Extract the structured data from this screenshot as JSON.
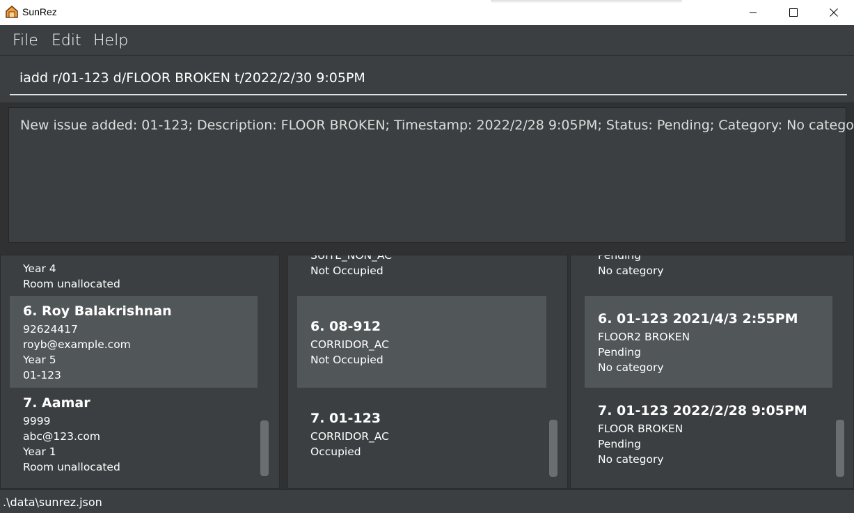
{
  "window": {
    "title": "SunRez"
  },
  "menu": {
    "file": "File",
    "edit": "Edit",
    "help": "Help"
  },
  "command": {
    "value": "iadd r/01-123 d/FLOOR BROKEN t/2022/2/30 9:05PM"
  },
  "result": {
    "text": "New issue added: 01-123; Description: FLOOR BROKEN; Timestamp: 2022/2/28 9:05PM; Status: Pending; Category: No category"
  },
  "residents": {
    "partial_top": {
      "year": "Year 4",
      "room": "Room unallocated"
    },
    "items": [
      {
        "title": "6.  Roy Balakrishnan",
        "phone": "92624417",
        "email": "royb@example.com",
        "year": "Year 5",
        "room": "01-123"
      },
      {
        "title": "7.  Aamar",
        "phone": "9999",
        "email": "abc@123.com",
        "year": "Year 1",
        "room": "Room unallocated"
      }
    ]
  },
  "rooms": {
    "partial_top": {
      "cut_type": "SUITE_NON_AC",
      "status": "Not Occupied"
    },
    "items": [
      {
        "title": "6.  08-912",
        "type": "CORRIDOR_AC",
        "status": "Not Occupied"
      },
      {
        "title": "7.  01-123",
        "type": "CORRIDOR_AC",
        "status": "Occupied"
      }
    ]
  },
  "issues": {
    "partial_top": {
      "cut_status": "Pending",
      "category": "No category"
    },
    "items": [
      {
        "title": "6.  01-123 2021/4/3 2:55PM",
        "description": "FLOOR2 BROKEN",
        "status": "Pending",
        "category": "No category"
      },
      {
        "title": "7.  01-123 2022/2/28 9:05PM",
        "description": "FLOOR BROKEN",
        "status": "Pending",
        "category": "No category"
      }
    ]
  },
  "status_bar": {
    "path": ".\\data\\sunrez.json"
  },
  "colors": {
    "background": "#3c3f41",
    "selected_card": "#515658",
    "text": "#ffffff"
  }
}
